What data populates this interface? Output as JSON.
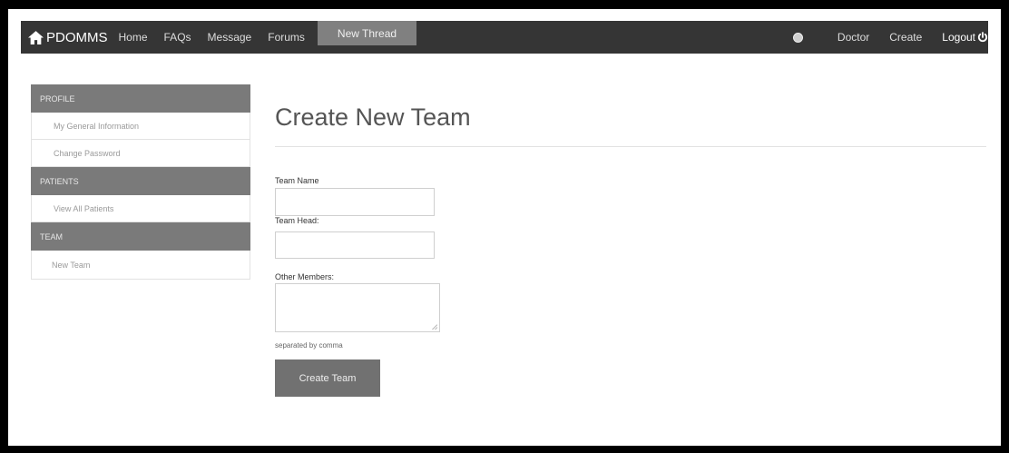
{
  "navbar": {
    "brand": "PDOMMS",
    "items": [
      {
        "label": "Home"
      },
      {
        "label": "FAQs"
      },
      {
        "label": "Message"
      },
      {
        "label": "Forums"
      },
      {
        "label": "New Thread"
      }
    ],
    "right": [
      {
        "label": "Doctor"
      },
      {
        "label": "Create"
      },
      {
        "label": "Logout"
      }
    ]
  },
  "sidebar": {
    "sections": [
      {
        "heading": "PROFILE",
        "items": [
          "My General Information",
          "Change Password"
        ]
      },
      {
        "heading": "PATIENTS",
        "items": [
          "View All Patients"
        ]
      },
      {
        "heading": "TEAM",
        "items": [
          "New Team"
        ]
      }
    ]
  },
  "main": {
    "title": "Create New Team",
    "team_name_label": "Team Name",
    "team_name_value": "",
    "team_head_label": "Team Head:",
    "team_head_value": "",
    "other_members_label": "Other Members:",
    "other_members_value": "",
    "hint": "separated by comma",
    "submit_label": "Create Team"
  }
}
